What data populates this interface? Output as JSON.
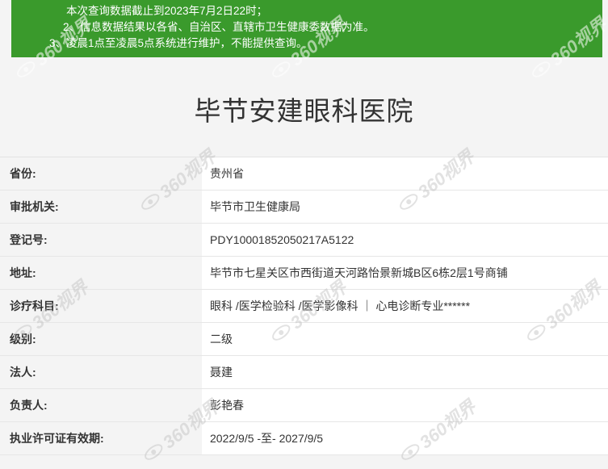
{
  "notice": {
    "lines": [
      "本次查询数据截止到2023年7月2日22时；",
      "2、信息数据结果以各省、自治区、直辖市卫生健康委数据为准。",
      "3、凌晨1点至凌晨5点系统进行维护，不能提供查询。"
    ]
  },
  "hospital": {
    "name": "毕节安建眼科医院"
  },
  "info": {
    "rows": [
      {
        "label": "省份:",
        "value": "贵州省"
      },
      {
        "label": "审批机关:",
        "value": "毕节市卫生健康局"
      },
      {
        "label": "登记号:",
        "value": "PDY10001852050217A5122"
      },
      {
        "label": "地址:",
        "value": "毕节市七星关区市西街道天河路怡景新城B区6栋2层1号商铺"
      },
      {
        "label": "诊疗科目:",
        "value": "眼科 /医学检验科 /医学影像科 ｜ 心电诊断专业******"
      },
      {
        "label": "级别:",
        "value": "二级"
      },
      {
        "label": "法人:",
        "value": "聂建"
      },
      {
        "label": "负责人:",
        "value": "彭艳春"
      },
      {
        "label": "执业许可证有效期:",
        "value": "2022/9/5 -至- 2027/9/5"
      }
    ]
  },
  "watermark": {
    "text": "360视界",
    "icon": "eye-logo-icon"
  }
}
